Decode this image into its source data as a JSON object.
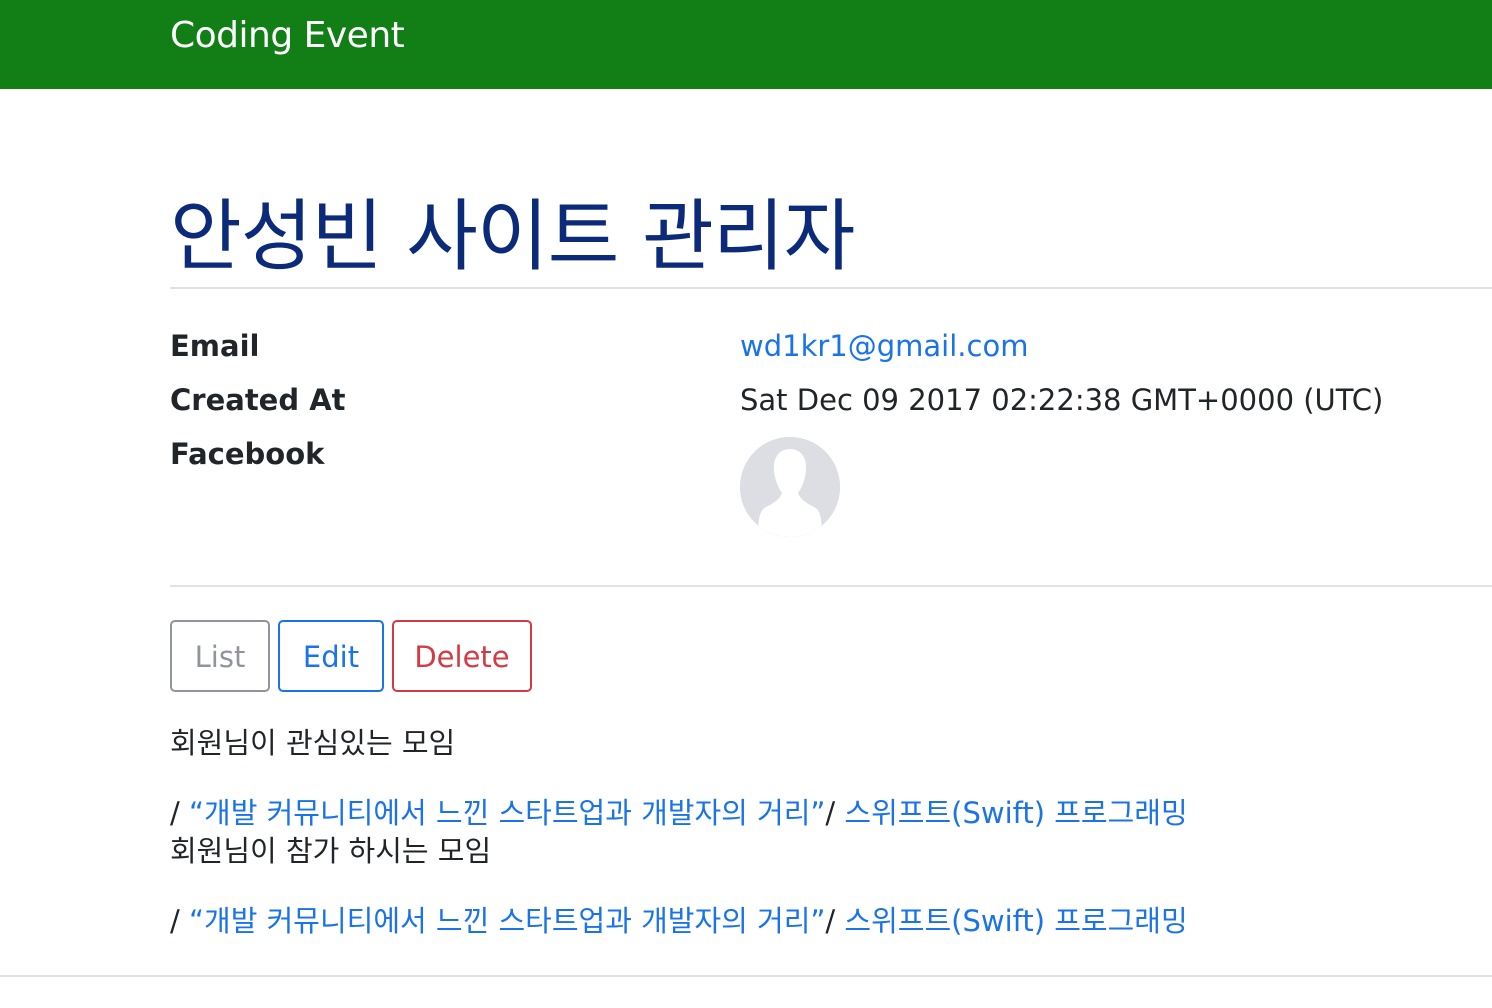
{
  "navbar": {
    "brand": "Coding Event",
    "color": "#117f16"
  },
  "profile": {
    "name": "안성빈 사이트 관리자",
    "email_label": "Email",
    "email": "wd1kr1@gmail.com",
    "created_label": "Created At",
    "created_at": "Sat Dec 09 2017 02:22:38 GMT+0000 (UTC)",
    "facebook_label": "Facebook",
    "facebook_avatar_icon": "default-user-avatar-icon"
  },
  "actions": {
    "list_label": "List",
    "edit_label": "Edit",
    "delete_label": "Delete"
  },
  "interested": {
    "label": "회원님이 관심있는 모임",
    "separator": "/ ",
    "events": [
      {
        "title": "“개발 커뮤니티에서 느낀 스타트업과 개발자의 거리”",
        "sep": "/ "
      },
      {
        "title": "스위프트(Swift) 프로그래밍"
      }
    ]
  },
  "attending": {
    "label": "회원님이 참가 하시는 모임",
    "separator": "/ ",
    "events": [
      {
        "title": "“개발 커뮤니티에서 느낀 스타트업과 개발자의 거리”",
        "sep": "/ "
      },
      {
        "title": "스위프트(Swift) 프로그래밍"
      }
    ]
  },
  "colors": {
    "title": "#0b2a7a",
    "link": "#1a73e8",
    "danger": "#d33a44",
    "secondary": "#8f959b"
  }
}
